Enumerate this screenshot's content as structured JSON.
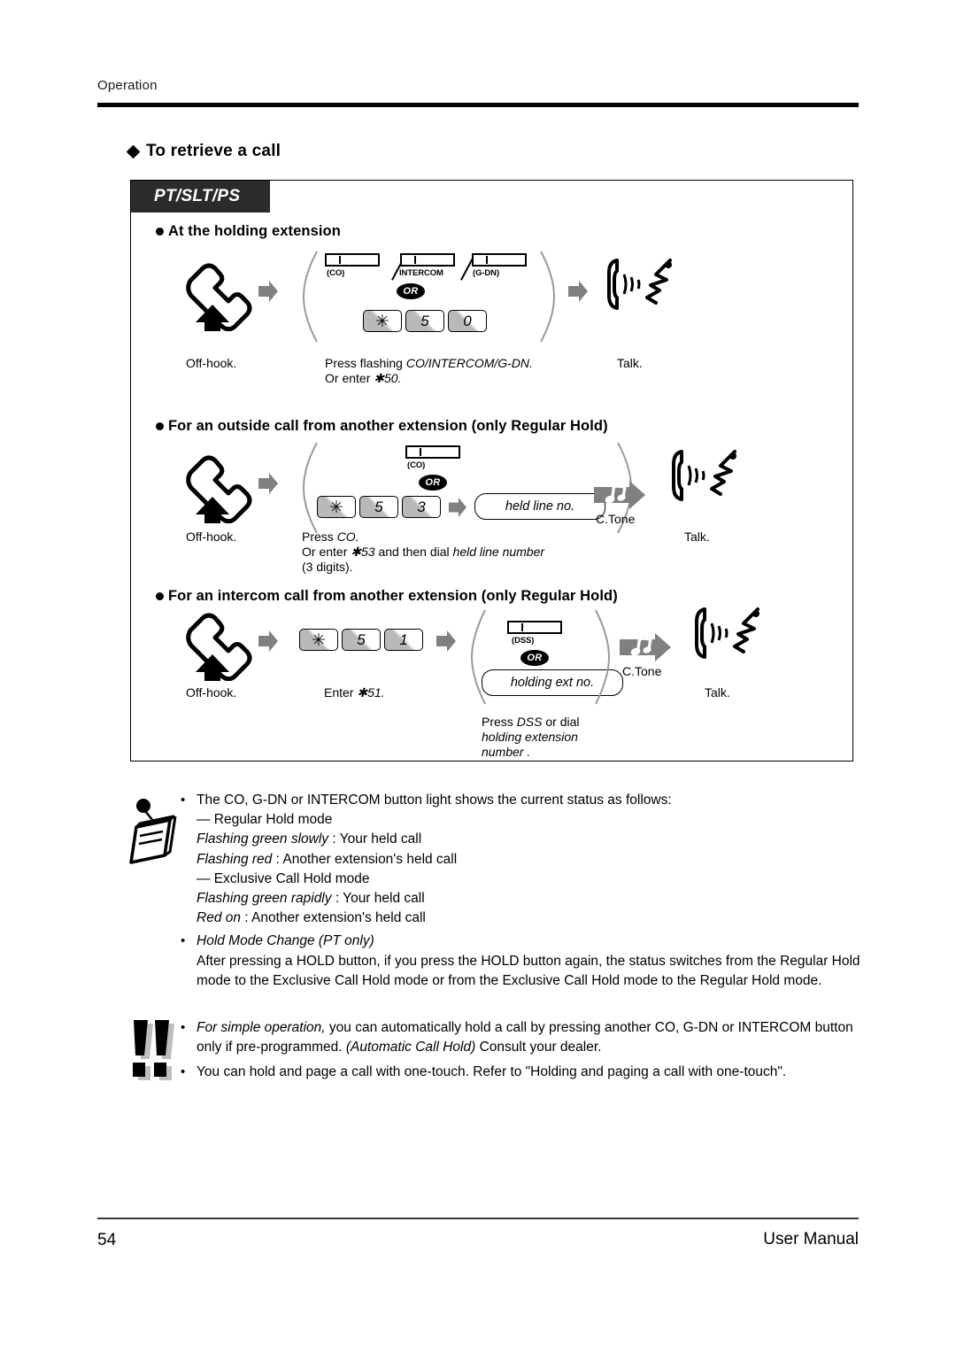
{
  "header": {
    "breadcrumb": "Operation"
  },
  "section": {
    "title": "To retrieve a call",
    "badge": "PT/SLT/PS"
  },
  "procedures": [
    {
      "heading": "At the holding extension",
      "buttons": [
        {
          "label": "(CO)",
          "name": "co-button"
        },
        {
          "label": "INTERCOM",
          "name": "intercom-button"
        },
        {
          "label": "(G-DN)",
          "name": "g-dn-button"
        }
      ],
      "or_label": "OR",
      "keys": [
        "✳",
        "5",
        "0"
      ],
      "captions": {
        "step1": "Off-hook.",
        "step2_line1_a": "Press flashing ",
        "step2_line1_b": "CO/INTERCOM/G-DN.",
        "step2_line2_a": "Or enter ",
        "step2_line2_b": "✱50.",
        "step3": "Talk."
      }
    },
    {
      "heading": "For an outside call from another extension (only Regular Hold)",
      "buttons": [
        {
          "label": "(CO)",
          "name": "co-button"
        }
      ],
      "or_label": "OR",
      "keys": [
        "✳",
        "5",
        "3"
      ],
      "pill": "held line no.",
      "ctone": "C.Tone",
      "captions": {
        "step1": "Off-hook.",
        "step2_line1_a": "Press ",
        "step2_line1_b": "CO.",
        "step2_line2_a": "Or enter ",
        "step2_line2_b": "✱53",
        "step2_line2_c": " and then dial ",
        "step2_line2_d": "held line number",
        "step2_line3": "(3 digits).",
        "step3": "Talk."
      }
    },
    {
      "heading": "For an intercom call from another extension (only Regular Hold)",
      "buttons": [
        {
          "label": "(DSS)",
          "name": "dss-button"
        }
      ],
      "or_label": "OR",
      "keys": [
        "✳",
        "5",
        "1"
      ],
      "pill": "holding ext no.",
      "ctone": "C.Tone",
      "captions": {
        "step1": "Off-hook.",
        "step2_a": "Enter ",
        "step2_b": "✱51.",
        "step3_line1_a": "Press ",
        "step3_line1_b": "DSS",
        "step3_line1_c": " or dial",
        "step3_line2": "holding extension",
        "step3_line3": "number .",
        "step4": "Talk."
      }
    }
  ],
  "notes": {
    "memo_icon": "note-icon",
    "bullet": "•",
    "item1": {
      "line1": "The CO, G-DN or INTERCOM button light shows the current status as follows:",
      "line2": "— Regular Hold mode",
      "line3_em": "Flashing green slowly",
      "line3_rest": "  : Your held call",
      "line4_em": "Flashing red",
      "line4_rest": " : Another extension's held call",
      "line5": "— Exclusive Call Hold mode",
      "line6_em": "Flashing green rapidly",
      "line6_rest": "  : Your held call",
      "line7_em": "Red on",
      "line7_rest": " : Another extension's held call"
    },
    "item2": {
      "title": "Hold Mode Change (PT only)",
      "body": "After pressing a HOLD button, if you press the HOLD button again, the status switches from the Regular Hold mode to the Exclusive Call Hold mode or from the Exclusive Call Hold mode to the Regular Hold mode."
    }
  },
  "tips": {
    "alert_icon": "double-exclamation-icon",
    "bullet": "•",
    "item1_em1": "For simple operation,",
    "item1_mid": "  you can automatically hold a call by pressing another CO, G-DN or INTERCOM button only if pre-programmed. ",
    "item1_em2": "(Automatic Call Hold)",
    "item1_end": "  Consult your dealer.",
    "item2": "You can hold and page a call with one-touch. Refer to \"Holding and paging a call with one-touch\"."
  },
  "footer": {
    "page_number": "54",
    "doc_title": "User Manual"
  }
}
